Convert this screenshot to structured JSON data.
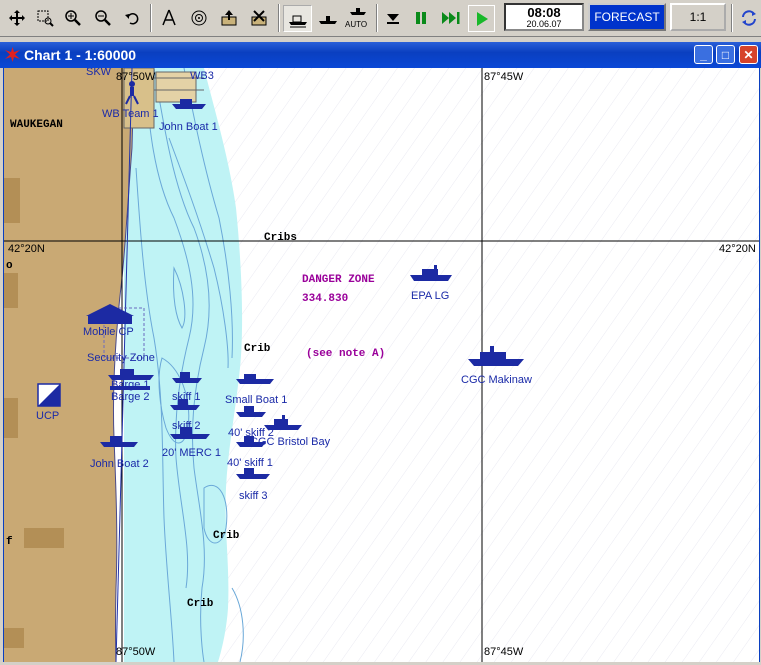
{
  "toolbar": {
    "clock_time": "08:08",
    "clock_date": "20.06.07",
    "forecast_label": "FORECAST",
    "scale_label": "1:1",
    "auto_label": "AUTO"
  },
  "window": {
    "title": "Chart 1 - 1:60000",
    "min_glyph": "_",
    "max_glyph": "□",
    "close_glyph": "✕"
  },
  "map": {
    "grid_labels": {
      "top_left_lon": "87°50W",
      "top_right_lon": "87°45W",
      "bottom_left_lon": "87°50W",
      "bottom_right_lon": "87°45W",
      "left_lat": "42°20N",
      "right_lat": "42°20N"
    },
    "places": {
      "waukegan": "WAUKEGAN",
      "skw": "SKW",
      "wb3": "WB3"
    },
    "features": {
      "cribs": "Cribs",
      "crib_1": "Crib",
      "crib_2": "Crib",
      "crib_3": "Crib",
      "danger_zone": "DANGER ZONE",
      "danger_freq": "334.830",
      "see_note": "(see note A)",
      "edge_o": "o",
      "edge_f": "f"
    },
    "units": {
      "wb_team_1": "WB Team 1",
      "john_boat_1": "John Boat 1",
      "epa_lg": "EPA LG",
      "mobile_cp": "Mobile CP",
      "security_zone": "Security Zone",
      "barge_1": "Barge 1",
      "barge_2": "Barge 2",
      "skiff_1": "skiff 1",
      "skiff_2": "skiff 2",
      "small_boat_1": "Small Boat 1",
      "forty_skiff_2": "40' skiff 2",
      "cgc_bristol_bay": "CGC Bristol Bay",
      "twenty_merc_1": "20' MERC 1",
      "forty_skiff_1": "40' skiff 1",
      "skiff_3": "skiff 3",
      "john_boat_2": "John Boat 2",
      "ucp": "UCP",
      "cgc_makinaw": "CGC Makinaw"
    },
    "colors": {
      "land": "#c9a974",
      "land_dark": "#b38f56",
      "shallow": "#bff3f5",
      "deep": "#ffffff",
      "depth_contour": "#6aa8d8",
      "unit_symbol": "#1c2aa3",
      "danger": "#9a009a"
    }
  }
}
